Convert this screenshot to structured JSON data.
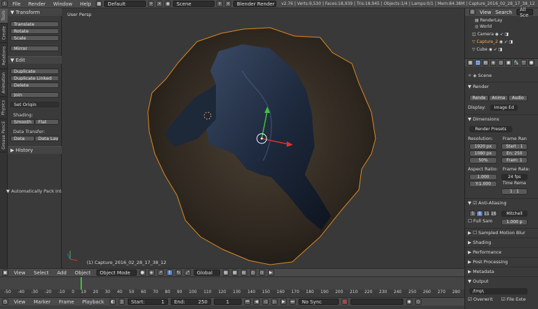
{
  "menubar": {
    "items": [
      "File",
      "Render",
      "Window",
      "Help"
    ],
    "layout": "Default",
    "scene": "Scene",
    "engine": "Blender Render",
    "stats": "v2.76 | Verts:9,530 | Faces:18,939 | Tris:18,945 | Objects:1/4 | Lamps:0/1 | Mem:84.38M | Capture_2016_02_28_17_38_12"
  },
  "vtabs": [
    "Tools",
    "Create",
    "Relations",
    "Animation",
    "Physics",
    "Grease Pencil"
  ],
  "shelf": {
    "transform_header": "Transform",
    "translate": "Translate",
    "rotate": "Rotate",
    "scale": "Scale",
    "mirror": "Mirror",
    "edit_header": "Edit",
    "duplicate": "Duplicate",
    "duplicate_linked": "Duplicate Linked",
    "delete": "Delete",
    "join": "Join",
    "set_origin": "Set Origin",
    "shading_label": "Shading:",
    "smooth": "Smooth",
    "flat": "Flat",
    "data_transfer_label": "Data Transfer:",
    "data": "Data",
    "data_layo": "Data Layo",
    "history_header": "History",
    "auto_pack": "Automatically Pack Into"
  },
  "viewport": {
    "label": "User Persp",
    "object_label": "(1) Capture_2016_02_28_17_38_12"
  },
  "vheader": {
    "view": "View",
    "select": "Select",
    "add": "Add",
    "object": "Object",
    "mode": "Object Mode",
    "orientation": "Global"
  },
  "timeline": {
    "ticks": [
      "-50",
      "-40",
      "-30",
      "-20",
      "-10",
      "0",
      "10",
      "20",
      "30",
      "40",
      "50",
      "60",
      "70",
      "80",
      "90",
      "100",
      "110",
      "120",
      "130",
      "140",
      "150",
      "160",
      "170",
      "180",
      "190",
      "200",
      "210",
      "220",
      "230",
      "240",
      "250",
      "260",
      "270",
      "280"
    ],
    "view": "View",
    "marker": "Marker",
    "frame": "Frame",
    "playback": "Playback",
    "start": "Start:",
    "start_val": "1",
    "end": "End:",
    "end_val": "250",
    "current": "1",
    "sync": "No Sync"
  },
  "outliner": {
    "view": "View",
    "search": "Search",
    "all": "All Sce",
    "rows": [
      "RenderLay",
      "World",
      "Camera",
      "Capture_2",
      "Cube"
    ]
  },
  "props": {
    "scene": "Scene",
    "render_header": "Render",
    "render_btn": "Rende",
    "anim_btn": "Anima",
    "audio_btn": "Audio",
    "display_label": "Display:",
    "display_val": "Image Ed",
    "dimensions_header": "Dimensions",
    "render_presets": "Render Presets",
    "resolution_label": "Resolution:",
    "frame_range_label": "Frame Ran",
    "res_x": "1920 px",
    "res_y": "1080 px",
    "res_pct": "50%",
    "start": "Start : 1",
    "end": "En: 250",
    "from": "Fram: 1",
    "aspect_label": "Aspect Ratio:",
    "framerate_label": "Frame Rate:",
    "aspect_x": "1.000",
    "aspect_y": "Y:1.000",
    "fps": "24 fps",
    "time_rema": "Time Rema",
    "time_vals": "1 : 1",
    "aa_header": "Anti-Aliasing",
    "aa_samples": [
      "5",
      "8",
      "11",
      "16"
    ],
    "aa_filter": "Mitchell",
    "full_sample": "Full Sam",
    "aa_size": "1.000 p",
    "motion_blur": "Sampled Motion Blur",
    "shading": "Shading",
    "performance": "Performance",
    "post_processing": "Post Processing",
    "metadata": "Metadata",
    "output_header": "Output",
    "output_path": "/tmp\\",
    "overwrite": "Overwrit",
    "file_ext": "File Exte"
  },
  "colors": {
    "selection_orange": "#e08a20",
    "active_blue": "#5680c2"
  }
}
